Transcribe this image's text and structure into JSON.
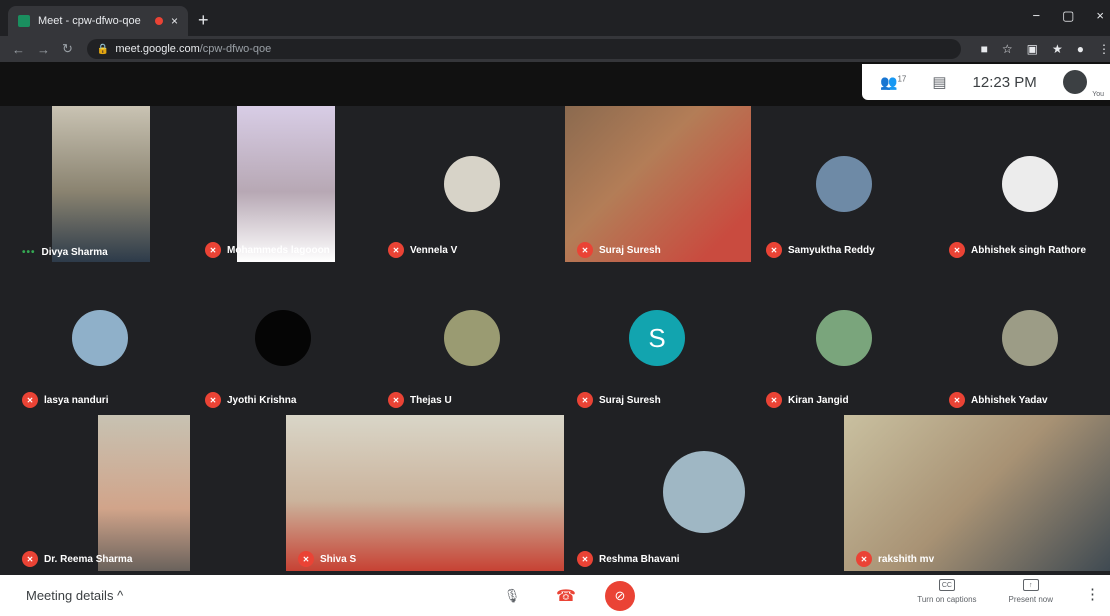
{
  "browser": {
    "tab_title": "Meet - cpw-dfwo-qoe",
    "tab_close": "×",
    "new_tab": "+",
    "win_min": "−",
    "win_max": "▢",
    "win_close": "×",
    "url_host": "meet.google.com",
    "url_path": "/cpw-dfwo-qoe"
  },
  "meeting": {
    "participant_count": "17",
    "time": "12:23 PM",
    "you_label": "You",
    "details_label": "Meeting details",
    "captions_label": "Turn on captions",
    "present_label": "Present now",
    "cc": "CC",
    "present_icon": "↑"
  },
  "participants": [
    {
      "name": "Divya Sharma"
    },
    {
      "name": "Mohammeds lagooon"
    },
    {
      "name": "Vennela V"
    },
    {
      "name": "Suraj Suresh"
    },
    {
      "name": "Samyuktha Reddy"
    },
    {
      "name": "Abhishek singh Rathore"
    },
    {
      "name": "lasya nanduri"
    },
    {
      "name": "Jyothi Krishna"
    },
    {
      "name": "Thejas U"
    },
    {
      "name": "Suraj Suresh",
      "initial": "S"
    },
    {
      "name": "Kiran Jangid"
    },
    {
      "name": "Abhishek Yadav"
    },
    {
      "name": "Dr. Reema Sharma"
    },
    {
      "name": "Shiva S"
    },
    {
      "name": "Reshma Bhavani"
    },
    {
      "name": "rakshith mv"
    }
  ],
  "colors": {
    "accent_red": "#ea4335",
    "tile_bg": "#202124",
    "initial_bg": "#12a4af"
  }
}
